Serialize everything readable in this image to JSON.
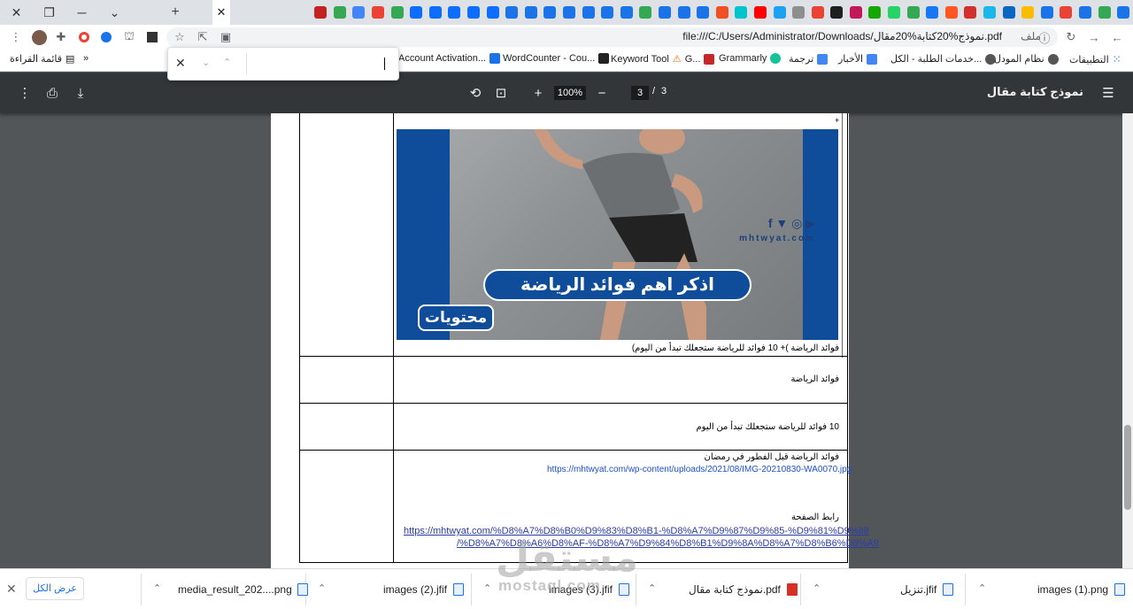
{
  "browser": {
    "tabs_favicon_colors": [
      "#1a73e8",
      "#34a853",
      "#1a73e8",
      "#ea4335",
      "#1a73e8",
      "#fbbc04",
      "#0a66c2",
      "#1ab7ea",
      "#d32f2f",
      "#ff5722",
      "#1877f2",
      "#34a853",
      "#25d366",
      "#14a800",
      "#c2185b",
      "#1f1f1f",
      "#ea4335",
      "#8e8e8e",
      "#1da1f2",
      "#ff0000",
      "#00c4cc",
      "#f25022",
      "#1a73e8",
      "#1a73e8",
      "#1a73e8",
      "#34a853",
      "#1a73e8",
      "#1a73e8",
      "#1a73e8",
      "#1a73e8",
      "#1a73e8",
      "#1a73e8",
      "#1a73e8",
      "#0d6efd",
      "#0d6efd",
      "#0d6efd",
      "#0d6efd",
      "#0d6efd",
      "#34a853",
      "#ea4335",
      "#4285f4",
      "#34a853",
      "#c5221f"
    ],
    "url_prefix": "ملف",
    "url": "file:///C:/Users/Administrator/Downloads/نموذج%20كتابة%20مقال.pdf",
    "bookmarks": {
      "apps": "التطبيقات",
      "moodle": "نظام المودل",
      "students": "خدمات الطلبة - الكل...",
      "news": "الأخبار",
      "translate": "ترجمة",
      "grammarly": "Grammarly",
      "keyword": "Keyword Tool",
      "keyword_icon_label": "G...",
      "wordcounter": "WordCounter - Cou...",
      "account": "Account Activation...",
      "more": "»",
      "reading_list": "قائمة القراءة"
    }
  },
  "pdf": {
    "title": "نموذج كتابة مقال",
    "zoom": "100%",
    "current_page": "3",
    "page_sep": "/",
    "total_pages": "3",
    "content": {
      "banner_headline": "اذكر اهم فوائد الرياضة",
      "banner_brand": "محتويات",
      "banner_site": "mhtwyat.com",
      "banner_social": "f  ▼  ◎  ▶",
      "caption": "فوائد الرياضة )+ 10 فوائد للرياضة ستجعلك تبدأ من اليوم)",
      "row2": "فوائد الرياضة",
      "row3": "10 فوائد للرياضة ستجعلك تبدأ من اليوم",
      "row4_label": "فوائد الرياضة قبل الفطور في رمضان",
      "row4_link": "https://mhtwyat.com/wp-content/uploads/2021/08/IMG-20210830-WA0070.jpg",
      "page_link_label": "رابط الصفحة",
      "page_link_1": "https://mhtwyat.com/%D8%A7%D8%B0%D9%83%D8%B1-%D8%A7%D9%87%D9%85-%D9%81%D9%88",
      "page_link_2": "/%D8%A7%D8%A6%D8%AF-%D8%A7%D9%84%D8%B1%D9%8A%D8%A7%D8%B6%D8%A9",
      "marker": "+"
    }
  },
  "downloads": {
    "show_all": "عرض الكل",
    "items": [
      {
        "name": "images (1).png",
        "type": "png"
      },
      {
        "name": "تنزيل.jfif",
        "type": "jfif"
      },
      {
        "name": "نموذج كتابة مقال.pdf",
        "type": "pdf"
      },
      {
        "name": "images (3).jfif",
        "type": "jfif"
      },
      {
        "name": "images (2).jfif",
        "type": "jfif"
      },
      {
        "name": "media_result_202....png",
        "type": "png"
      }
    ]
  },
  "watermark": {
    "logo": "مستقل",
    "site": "mostaql.com"
  }
}
